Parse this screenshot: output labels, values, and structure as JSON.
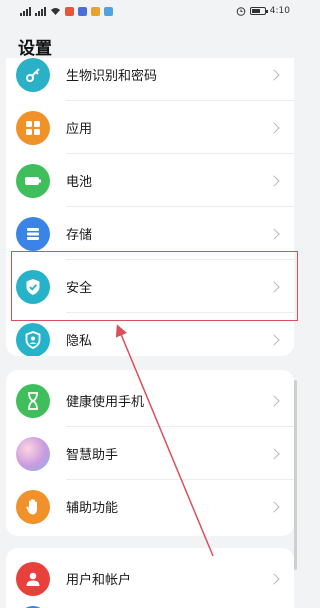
{
  "status_bar": {
    "time": "4:10",
    "icons": [
      "sim1-signal-icon",
      "sim2-signal-icon",
      "wifi-icon",
      "app-notification-icons",
      "alarm-icon",
      "battery-icon"
    ]
  },
  "page": {
    "title": "设置"
  },
  "settings_items": [
    {
      "id": "biometrics",
      "label": "生物识别和密码",
      "icon": "key-icon",
      "color": "#2ab0c7"
    },
    {
      "id": "apps",
      "label": "应用",
      "icon": "apps-grid-icon",
      "color": "#f0912a"
    },
    {
      "id": "battery",
      "label": "电池",
      "icon": "battery-icon",
      "color": "#3fbf5c"
    },
    {
      "id": "storage",
      "label": "存储",
      "icon": "storage-icon",
      "color": "#3a84e8"
    },
    {
      "id": "security",
      "label": "安全",
      "icon": "shield-check-icon",
      "color": "#26b3c9"
    },
    {
      "id": "privacy",
      "label": "隐私",
      "icon": "privacy-icon",
      "color": "#26b3c9"
    },
    {
      "id": "digital-balance",
      "label": "健康使用手机",
      "icon": "hourglass-icon",
      "color": "#3fbf5c"
    },
    {
      "id": "assistant",
      "label": "智慧助手",
      "icon": "assistant-icon",
      "color": "#c89be0"
    },
    {
      "id": "accessibility",
      "label": "辅助功能",
      "icon": "hand-icon",
      "color": "#f0912a"
    },
    {
      "id": "users",
      "label": "用户和帐户",
      "icon": "user-icon",
      "color": "#e8413c"
    }
  ],
  "annotation": {
    "highlighted_item": "security",
    "color": "#d9505a"
  }
}
